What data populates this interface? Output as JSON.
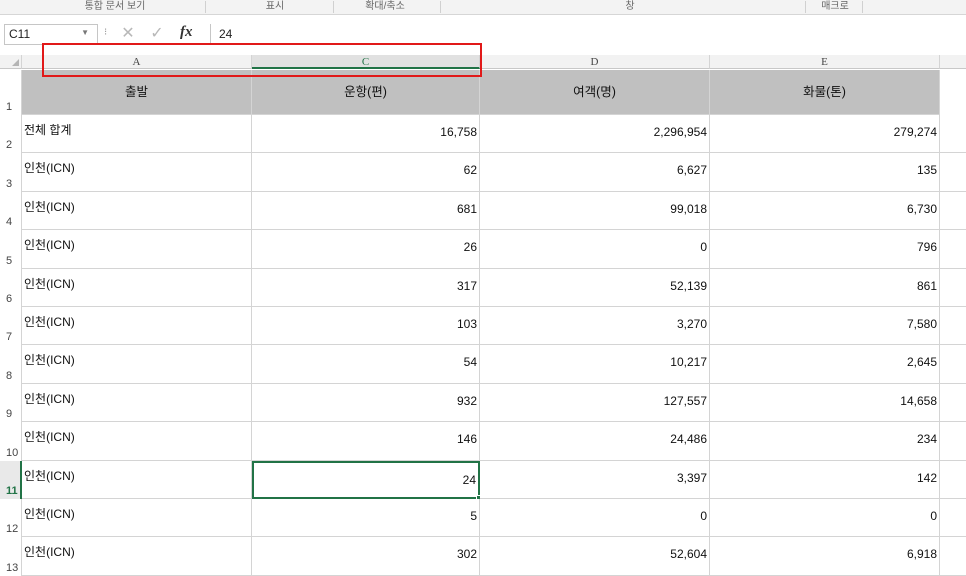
{
  "ribbon": {
    "groups": [
      "통합 문서 보기",
      "표시",
      "확대/축소",
      "창",
      "매크로"
    ]
  },
  "formula_bar": {
    "name_box": "C11",
    "cancel_glyph": "✕",
    "enter_glyph": "✓",
    "fx_label": "fx",
    "value": "24"
  },
  "columns": [
    "A",
    "C",
    "D",
    "E"
  ],
  "selected_column": "C",
  "header_row": [
    "출발",
    "운항(편)",
    "여객(명)",
    "화물(톤)"
  ],
  "rows": [
    {
      "num": "2",
      "cells": [
        "전체 합계",
        "16,758",
        "2,296,954",
        "279,274"
      ]
    },
    {
      "num": "3",
      "cells": [
        "인천(ICN)",
        "62",
        "6,627",
        "135"
      ]
    },
    {
      "num": "4",
      "cells": [
        "인천(ICN)",
        "681",
        "99,018",
        "6,730"
      ]
    },
    {
      "num": "5",
      "cells": [
        "인천(ICN)",
        "26",
        "0",
        "796"
      ]
    },
    {
      "num": "6",
      "cells": [
        "인천(ICN)",
        "317",
        "52,139",
        "861"
      ]
    },
    {
      "num": "7",
      "cells": [
        "인천(ICN)",
        "103",
        "3,270",
        "7,580"
      ]
    },
    {
      "num": "8",
      "cells": [
        "인천(ICN)",
        "54",
        "10,217",
        "2,645"
      ]
    },
    {
      "num": "9",
      "cells": [
        "인천(ICN)",
        "932",
        "127,557",
        "14,658"
      ]
    },
    {
      "num": "10",
      "cells": [
        "인천(ICN)",
        "146",
        "24,486",
        "234"
      ]
    },
    {
      "num": "11",
      "cells": [
        "인천(ICN)",
        "24",
        "3,397",
        "142"
      ]
    },
    {
      "num": "12",
      "cells": [
        "인천(ICN)",
        "5",
        "0",
        "0"
      ]
    },
    {
      "num": "13",
      "cells": [
        "인천(ICN)",
        "302",
        "52,604",
        "6,918"
      ]
    }
  ],
  "header_row_num": "1",
  "active_cell": "C11",
  "colors": {
    "selection_green": "#217346",
    "highlight_red": "#e11919",
    "header_fill": "#c0c0c0"
  }
}
